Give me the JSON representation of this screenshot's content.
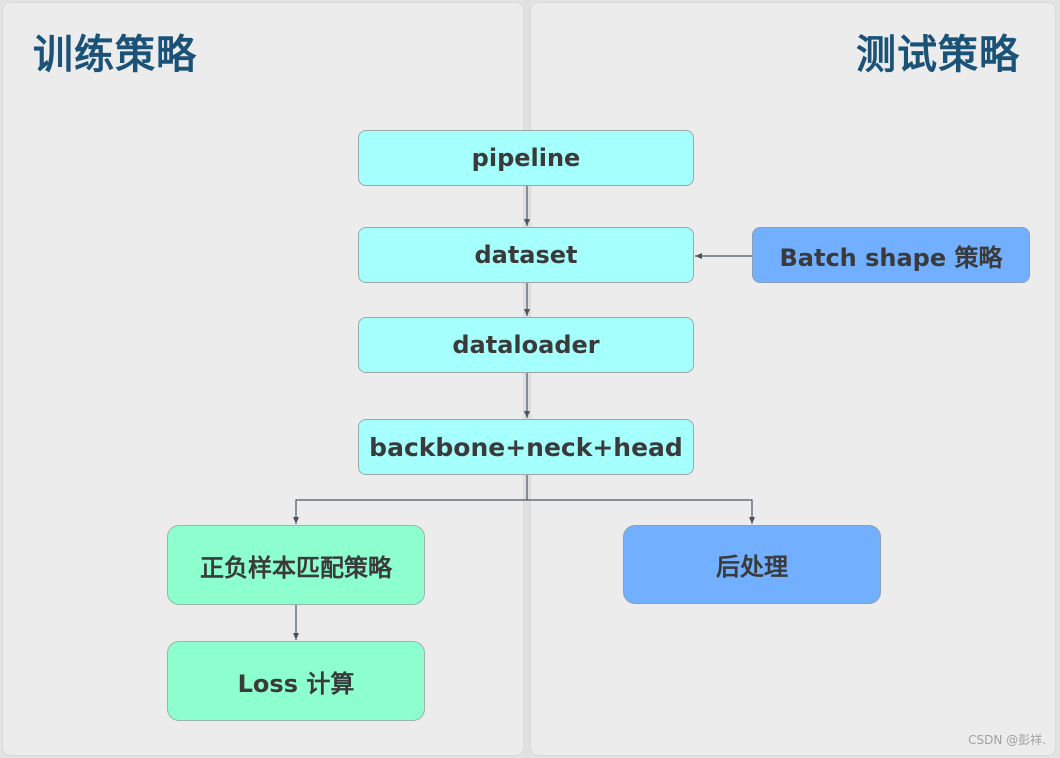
{
  "panels": {
    "left_title": "训练策略",
    "right_title": "测试策略"
  },
  "nodes": {
    "pipeline": "pipeline",
    "dataset": "dataset",
    "dataloader": "dataloader",
    "model": "backbone+neck+head",
    "batch_shape": "Batch shape 策略",
    "assigner": "正负样本匹配策略",
    "loss": "Loss 计算",
    "postprocess": "后处理"
  },
  "edges": [
    {
      "from": "pipeline",
      "to": "dataset"
    },
    {
      "from": "batch_shape",
      "to": "dataset"
    },
    {
      "from": "dataset",
      "to": "dataloader"
    },
    {
      "from": "dataloader",
      "to": "model"
    },
    {
      "from": "model",
      "to": "assigner"
    },
    {
      "from": "model",
      "to": "postprocess"
    },
    {
      "from": "assigner",
      "to": "loss"
    }
  ],
  "colors": {
    "title": "#1a5278",
    "core_node": "#a5fffd",
    "test_node": "#72afff",
    "train_node": "#8dffcf",
    "edge": "#4a5560"
  },
  "watermark": "CSDN @彭祥."
}
